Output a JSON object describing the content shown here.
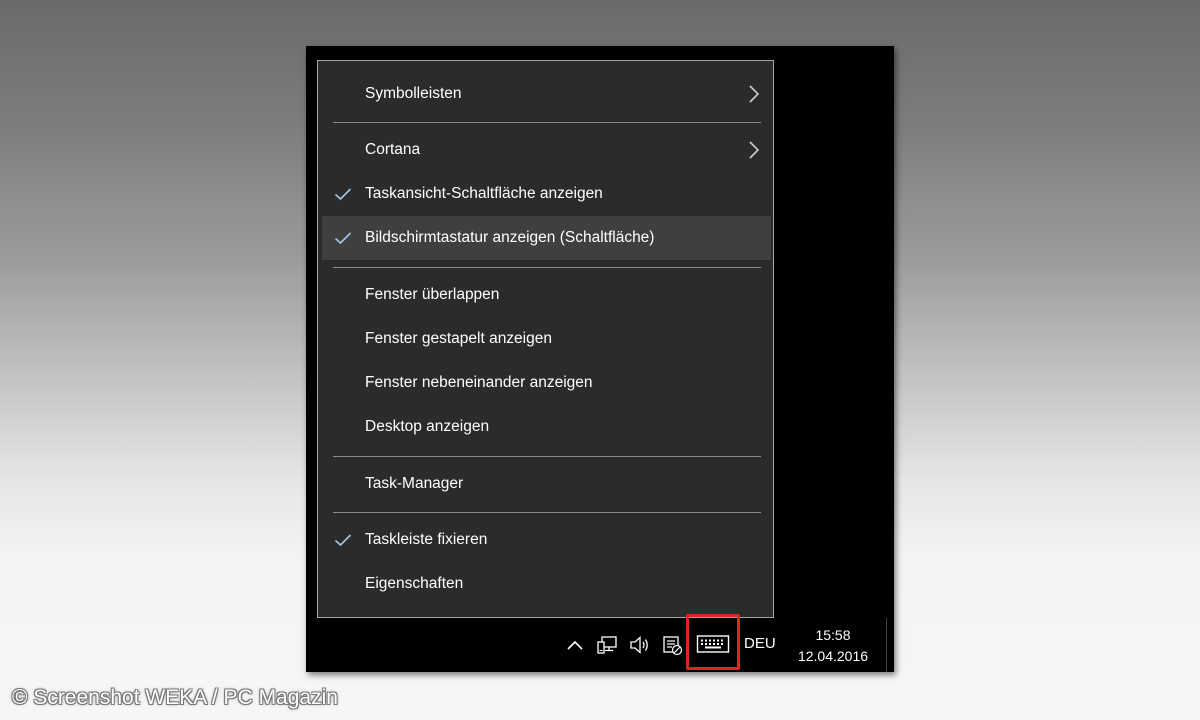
{
  "context_menu": {
    "items": [
      {
        "label": "Symbolleisten",
        "checked": false,
        "submenu": true
      },
      {
        "label": "Cortana",
        "checked": false,
        "submenu": true
      },
      {
        "label": "Taskansicht-Schaltfläche anzeigen",
        "checked": true,
        "submenu": false
      },
      {
        "label": "Bildschirmtastatur anzeigen (Schaltfläche)",
        "checked": true,
        "submenu": false,
        "highlighted": true
      },
      {
        "label": "Fenster überlappen",
        "checked": false,
        "submenu": false
      },
      {
        "label": "Fenster gestapelt anzeigen",
        "checked": false,
        "submenu": false
      },
      {
        "label": "Fenster nebeneinander anzeigen",
        "checked": false,
        "submenu": false
      },
      {
        "label": "Desktop anzeigen",
        "checked": false,
        "submenu": false
      },
      {
        "label": "Task-Manager",
        "checked": false,
        "submenu": false
      },
      {
        "label": "Taskleiste fixieren",
        "checked": true,
        "submenu": false
      },
      {
        "label": "Eigenschaften",
        "checked": false,
        "submenu": false
      }
    ]
  },
  "taskbar": {
    "tray_icons": [
      "chevron-up-icon",
      "network-icon",
      "volume-icon",
      "action-center-icon",
      "keyboard-icon"
    ],
    "language": "DEU",
    "time": "15:58",
    "date": "12.04.2016"
  },
  "credit": "© Screenshot WEKA / PC Magazin",
  "colors": {
    "menu_bg": "#2b2b2b",
    "menu_highlight": "#3f3f3f",
    "check_color": "#9fc8e8",
    "highlight_box": "#d9281c"
  }
}
